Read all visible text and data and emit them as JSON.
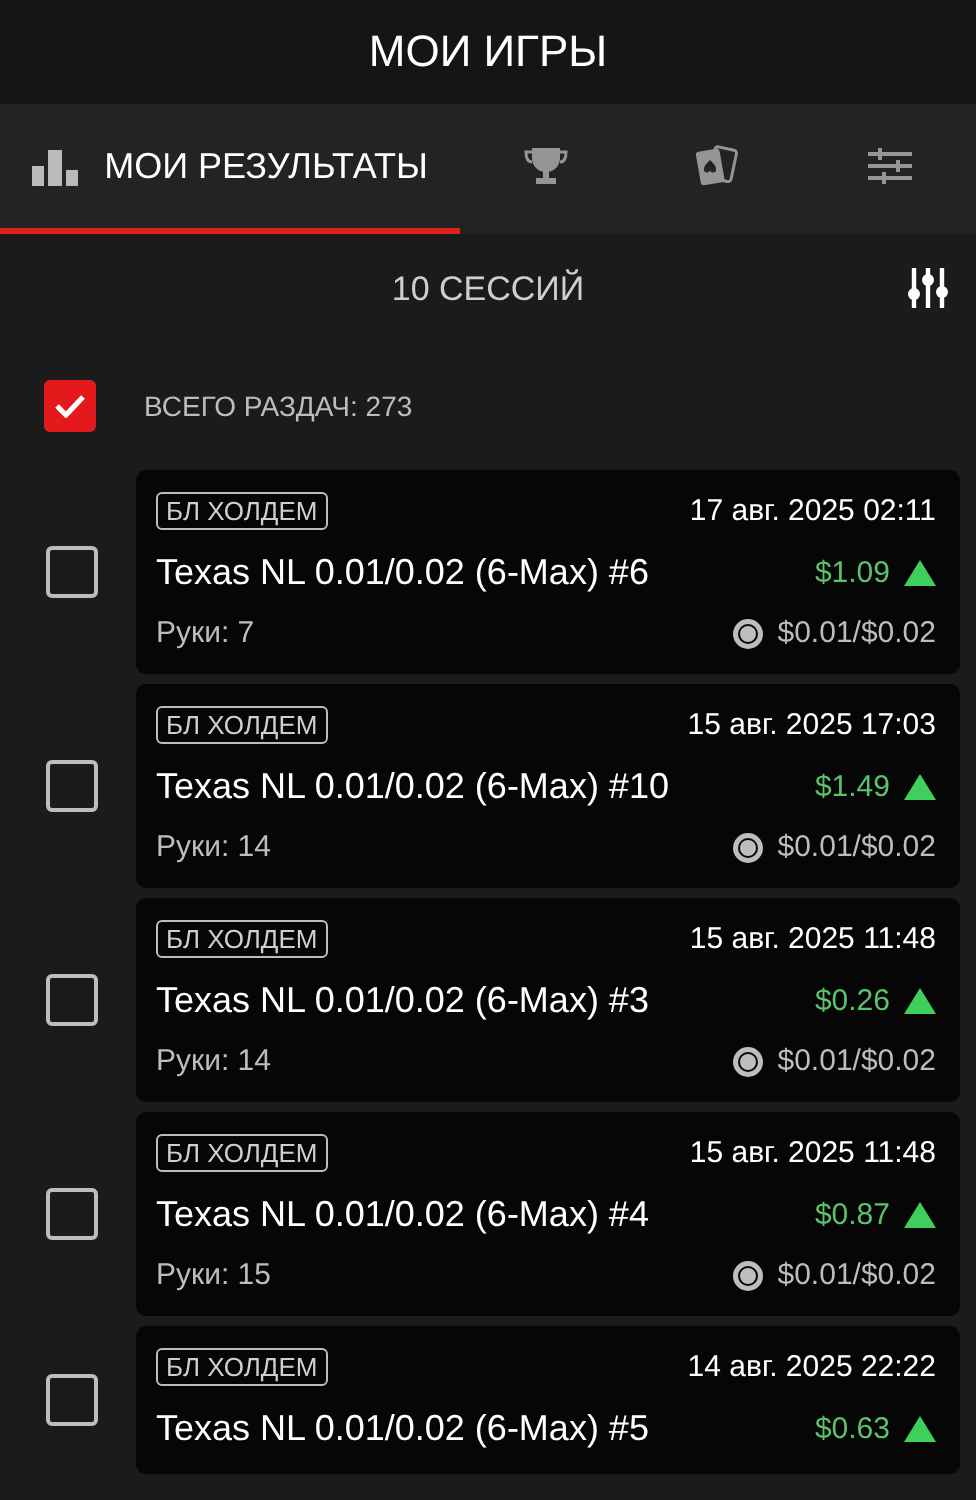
{
  "header": {
    "title": "МОИ ИГРЫ"
  },
  "tabs": [
    {
      "kind": "results",
      "label": "МОИ РЕЗУЛЬТАТЫ",
      "selected": true
    },
    {
      "kind": "trophy",
      "selected": false
    },
    {
      "kind": "cards",
      "selected": false
    },
    {
      "kind": "settings",
      "selected": false
    }
  ],
  "summary": {
    "sessions": "10 СЕССИЙ",
    "select_all": {
      "checked": true,
      "label": "ВСЕГО РАЗДАЧ:",
      "count": "273"
    }
  },
  "sessions": [
    {
      "checked": false,
      "tag": "БЛ ХОЛДЕМ",
      "date": "17 авг. 2025 02:11",
      "name": "Texas NL 0.01/0.02 (6-Max) #6",
      "amount": "$1.09",
      "rising": true,
      "hands": "Руки: 7",
      "stakes": "$0.01/$0.02"
    },
    {
      "checked": false,
      "tag": "БЛ ХОЛДЕМ",
      "date": "15 авг. 2025 17:03",
      "name": "Texas NL 0.01/0.02 (6-Max) #10",
      "amount": "$1.49",
      "rising": true,
      "hands": "Руки: 14",
      "stakes": "$0.01/$0.02"
    },
    {
      "checked": false,
      "tag": "БЛ ХОЛДЕМ",
      "date": "15 авг. 2025 11:48",
      "name": "Texas NL 0.01/0.02 (6-Max) #3",
      "amount": "$0.26",
      "rising": true,
      "hands": "Руки: 14",
      "stakes": "$0.01/$0.02"
    },
    {
      "checked": false,
      "tag": "БЛ ХОЛДЕМ",
      "date": "15 авг. 2025 11:48",
      "name": "Texas NL 0.01/0.02 (6-Max) #4",
      "amount": "$0.87",
      "rising": true,
      "hands": "Руки: 15",
      "stakes": "$0.01/$0.02"
    },
    {
      "checked": false,
      "tag": "БЛ ХОЛДЕМ",
      "date": "14 авг. 2025 22:22",
      "name": "Texas NL 0.01/0.02 (6-Max) #5",
      "amount": "$0.63",
      "rising": true
    }
  ]
}
